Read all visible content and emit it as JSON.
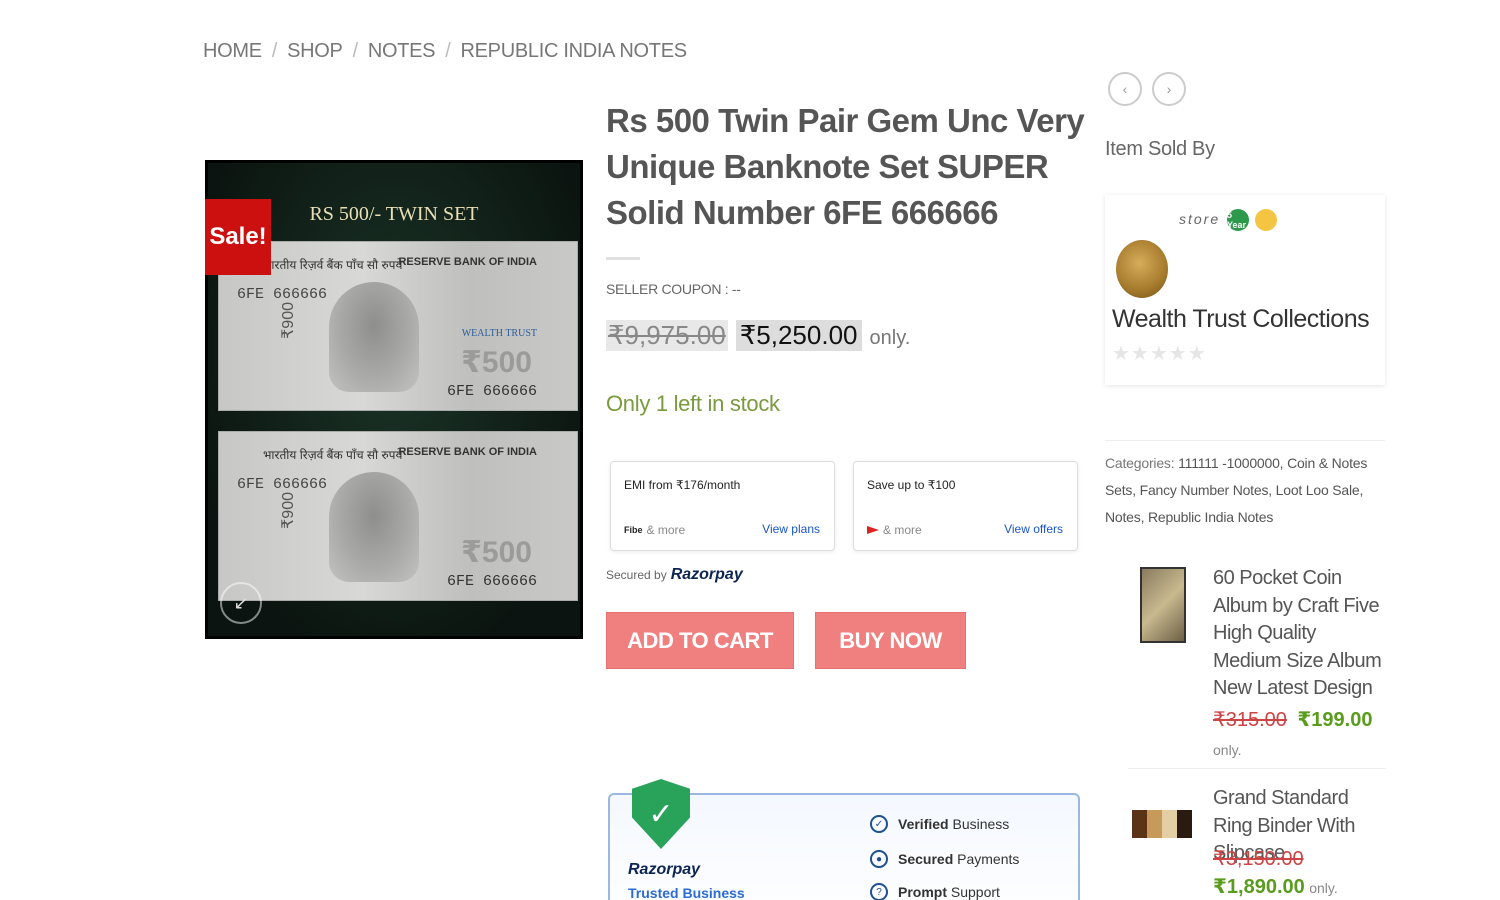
{
  "breadcrumb": {
    "home": "HOME",
    "shop": "SHOP",
    "notes": "NOTES",
    "category": "REPUBLIC INDIA NOTES",
    "separator": "/"
  },
  "gallery": {
    "sale_badge": "Sale!",
    "image_title": "RS 500/- TWIN SET",
    "note_bank": "RESERVE BANK OF INDIA",
    "note_hindi": "भारतीय रिज़र्व बैंक   पाँच सौ रुपये",
    "note_serial_top": "6FE 666666",
    "note_serial_bottom": "6FE 666666",
    "note_denom": "₹500",
    "note_vertical": "₹900",
    "note_watermark": "WEALTH TRUST",
    "zoom_icon": "expand-icon"
  },
  "product": {
    "title": "Rs 500 Twin Pair Gem Unc Very Unique Banknote Set SUPER Solid Number 6FE 666666",
    "seller_coupon": "SELLER COUPON : --",
    "old_price": "₹9,975.00",
    "new_price": "₹5,250.00",
    "price_suffix": "only.",
    "stock": "Only 1 left in stock"
  },
  "razorpay": {
    "emi": {
      "heading": "EMI from ₹176/month",
      "provider": "Fibe",
      "more": "& more",
      "link": "View plans"
    },
    "offers": {
      "heading": "Save up to ₹100",
      "more": "& more",
      "link": "View offers"
    },
    "secured_label": "Secured by",
    "brand": "Razorpay"
  },
  "actions": {
    "add_to_cart": "ADD TO CART",
    "buy_now": "BUY NOW"
  },
  "trust": {
    "brand": "Razorpay",
    "tagline": "Trusted Business",
    "features": [
      {
        "bold": "Verified",
        "rest": "Business"
      },
      {
        "bold": "Secured",
        "rest": "Payments"
      },
      {
        "bold": "Prompt",
        "rest": "Support"
      }
    ]
  },
  "sidebar": {
    "sold_by": "Item Sold By",
    "store": {
      "label": "store",
      "badge_years": "5 Year",
      "name": "Wealth Trust Collections",
      "stars": "★★★★★"
    },
    "categories_label": "Categories:",
    "categories": "111111 -1000000, Coin & Notes Sets, Fancy Number Notes, Loot Loo Sale, Notes, Republic India Notes",
    "products": [
      {
        "name": "60 Pocket Coin Album by Craft Five High Quality Medium Size Album New Latest Design",
        "old_price": "₹315.00",
        "new_price": "₹199.00",
        "suffix": "only."
      },
      {
        "name": "Grand Standard Ring Binder With Slipcase",
        "old_price": "₹3,150.00",
        "new_price": "₹1,890.00",
        "suffix": "only."
      }
    ]
  },
  "colors": {
    "sale_red": "#cc1010",
    "button_pink": "#f08080",
    "stock_green": "#7a9a3e",
    "price_green": "#5a9c1d",
    "link_blue": "#1a56c9"
  }
}
